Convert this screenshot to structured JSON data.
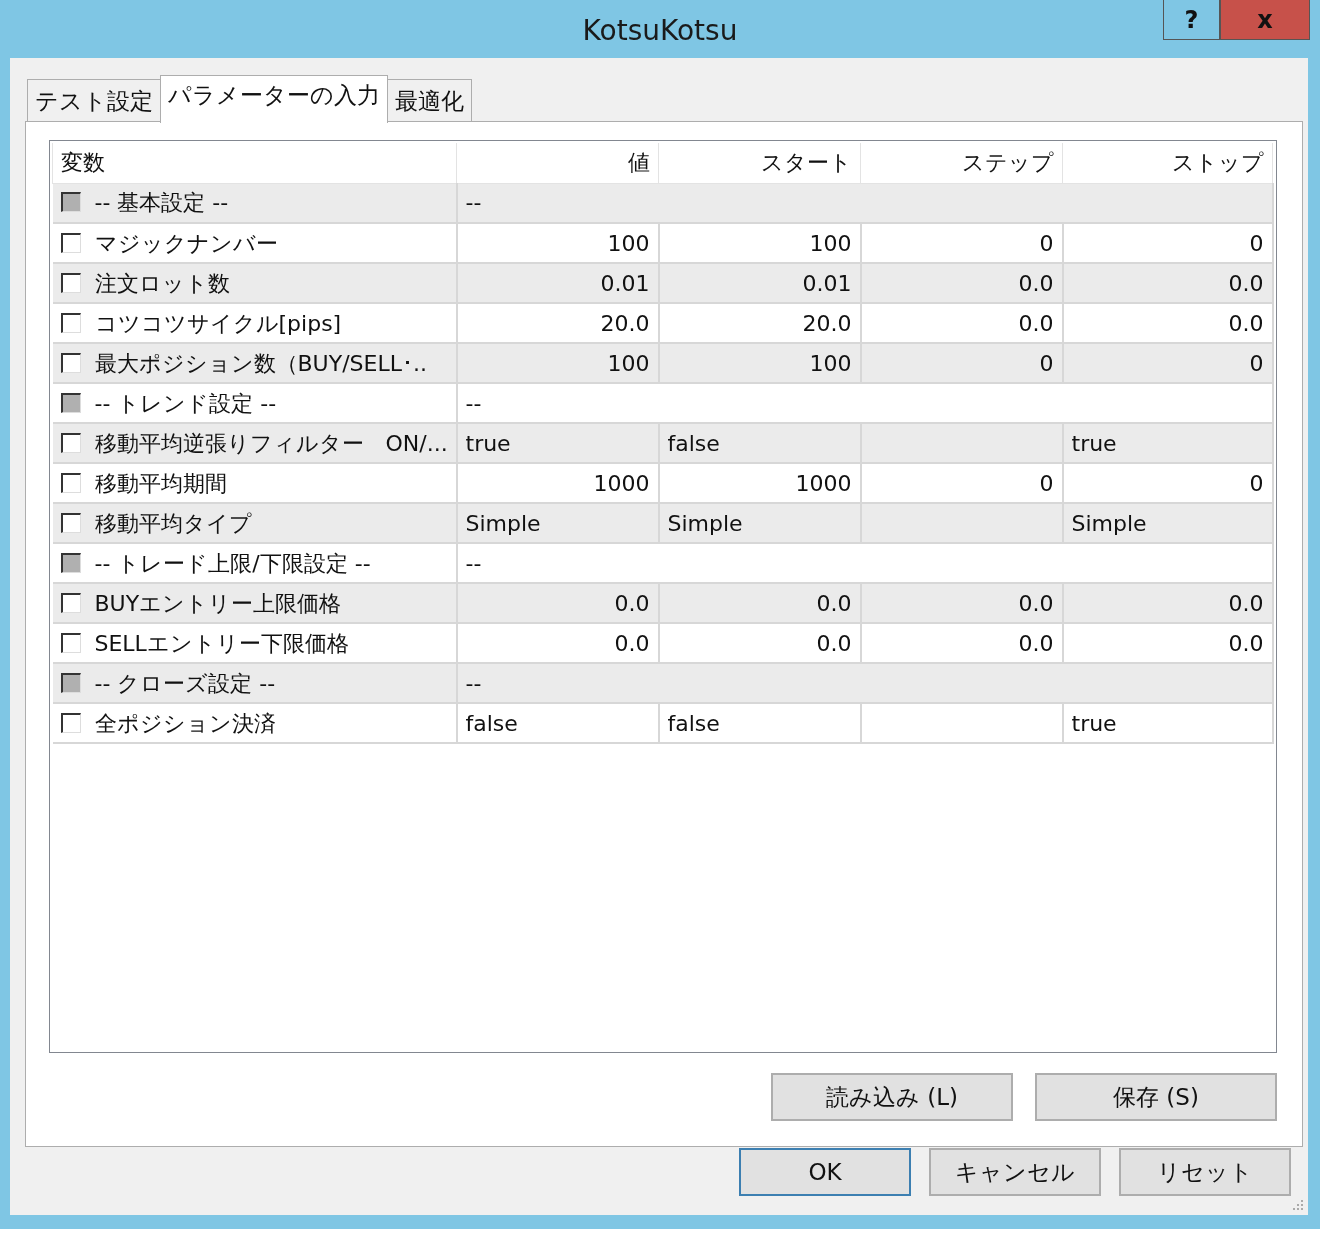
{
  "window": {
    "title": "KotsuKotsu",
    "help_button": "?",
    "close_button": "x"
  },
  "tabs": [
    {
      "label": "テスト設定",
      "selected": false
    },
    {
      "label": "パラメーターの入力",
      "selected": true
    },
    {
      "label": "最適化",
      "selected": false
    }
  ],
  "table": {
    "columns": [
      "変数",
      "値",
      "スタート",
      "ステップ",
      "ストップ"
    ],
    "rows": [
      {
        "kind": "section",
        "name": "-- 基本設定 --",
        "checked": false,
        "disabled": true,
        "value": "--"
      },
      {
        "kind": "number",
        "name": "マジックナンバー",
        "checked": false,
        "disabled": false,
        "value": "100",
        "start": "100",
        "step": "0",
        "stop": "0"
      },
      {
        "kind": "number",
        "name": "注文ロット数",
        "checked": false,
        "disabled": false,
        "value": "0.01",
        "start": "0.01",
        "step": "0.0",
        "stop": "0.0"
      },
      {
        "kind": "number",
        "name": "コツコツサイクル[pips]",
        "checked": false,
        "disabled": false,
        "value": "20.0",
        "start": "20.0",
        "step": "0.0",
        "stop": "0.0"
      },
      {
        "kind": "number",
        "name": "最大ポジション数（BUY/SELL･..",
        "checked": false,
        "disabled": false,
        "value": "100",
        "start": "100",
        "step": "0",
        "stop": "0"
      },
      {
        "kind": "section",
        "name": "-- トレンド設定 --",
        "checked": false,
        "disabled": true,
        "value": "--"
      },
      {
        "kind": "choice",
        "name": "移動平均逆張りフィルター　ON/...",
        "checked": false,
        "disabled": false,
        "value": "true",
        "start": "false",
        "stop": "true"
      },
      {
        "kind": "number",
        "name": "移動平均期間",
        "checked": false,
        "disabled": false,
        "value": "1000",
        "start": "1000",
        "step": "0",
        "stop": "0"
      },
      {
        "kind": "choice",
        "name": "移動平均タイプ",
        "checked": false,
        "disabled": false,
        "value": "Simple",
        "start": "Simple",
        "stop": "Simple"
      },
      {
        "kind": "section",
        "name": "-- トレード上限/下限設定 --",
        "checked": false,
        "disabled": true,
        "value": "--"
      },
      {
        "kind": "number",
        "name": "BUYエントリー上限価格",
        "checked": false,
        "disabled": false,
        "value": "0.0",
        "start": "0.0",
        "step": "0.0",
        "stop": "0.0"
      },
      {
        "kind": "number",
        "name": "SELLエントリー下限価格",
        "checked": false,
        "disabled": false,
        "value": "0.0",
        "start": "0.0",
        "step": "0.0",
        "stop": "0.0"
      },
      {
        "kind": "section",
        "name": "-- クローズ設定 --",
        "checked": false,
        "disabled": true,
        "value": "--"
      },
      {
        "kind": "choice",
        "name": "全ポジション決済",
        "checked": false,
        "disabled": false,
        "value": "false",
        "start": "false",
        "stop": "true"
      }
    ]
  },
  "panel_buttons": [
    "読み込み (L)",
    "保存 (S)"
  ],
  "dialog_buttons": [
    {
      "label": "OK",
      "default": true
    },
    {
      "label": "キャンセル",
      "default": false
    },
    {
      "label": "リセット",
      "default": false
    }
  ]
}
